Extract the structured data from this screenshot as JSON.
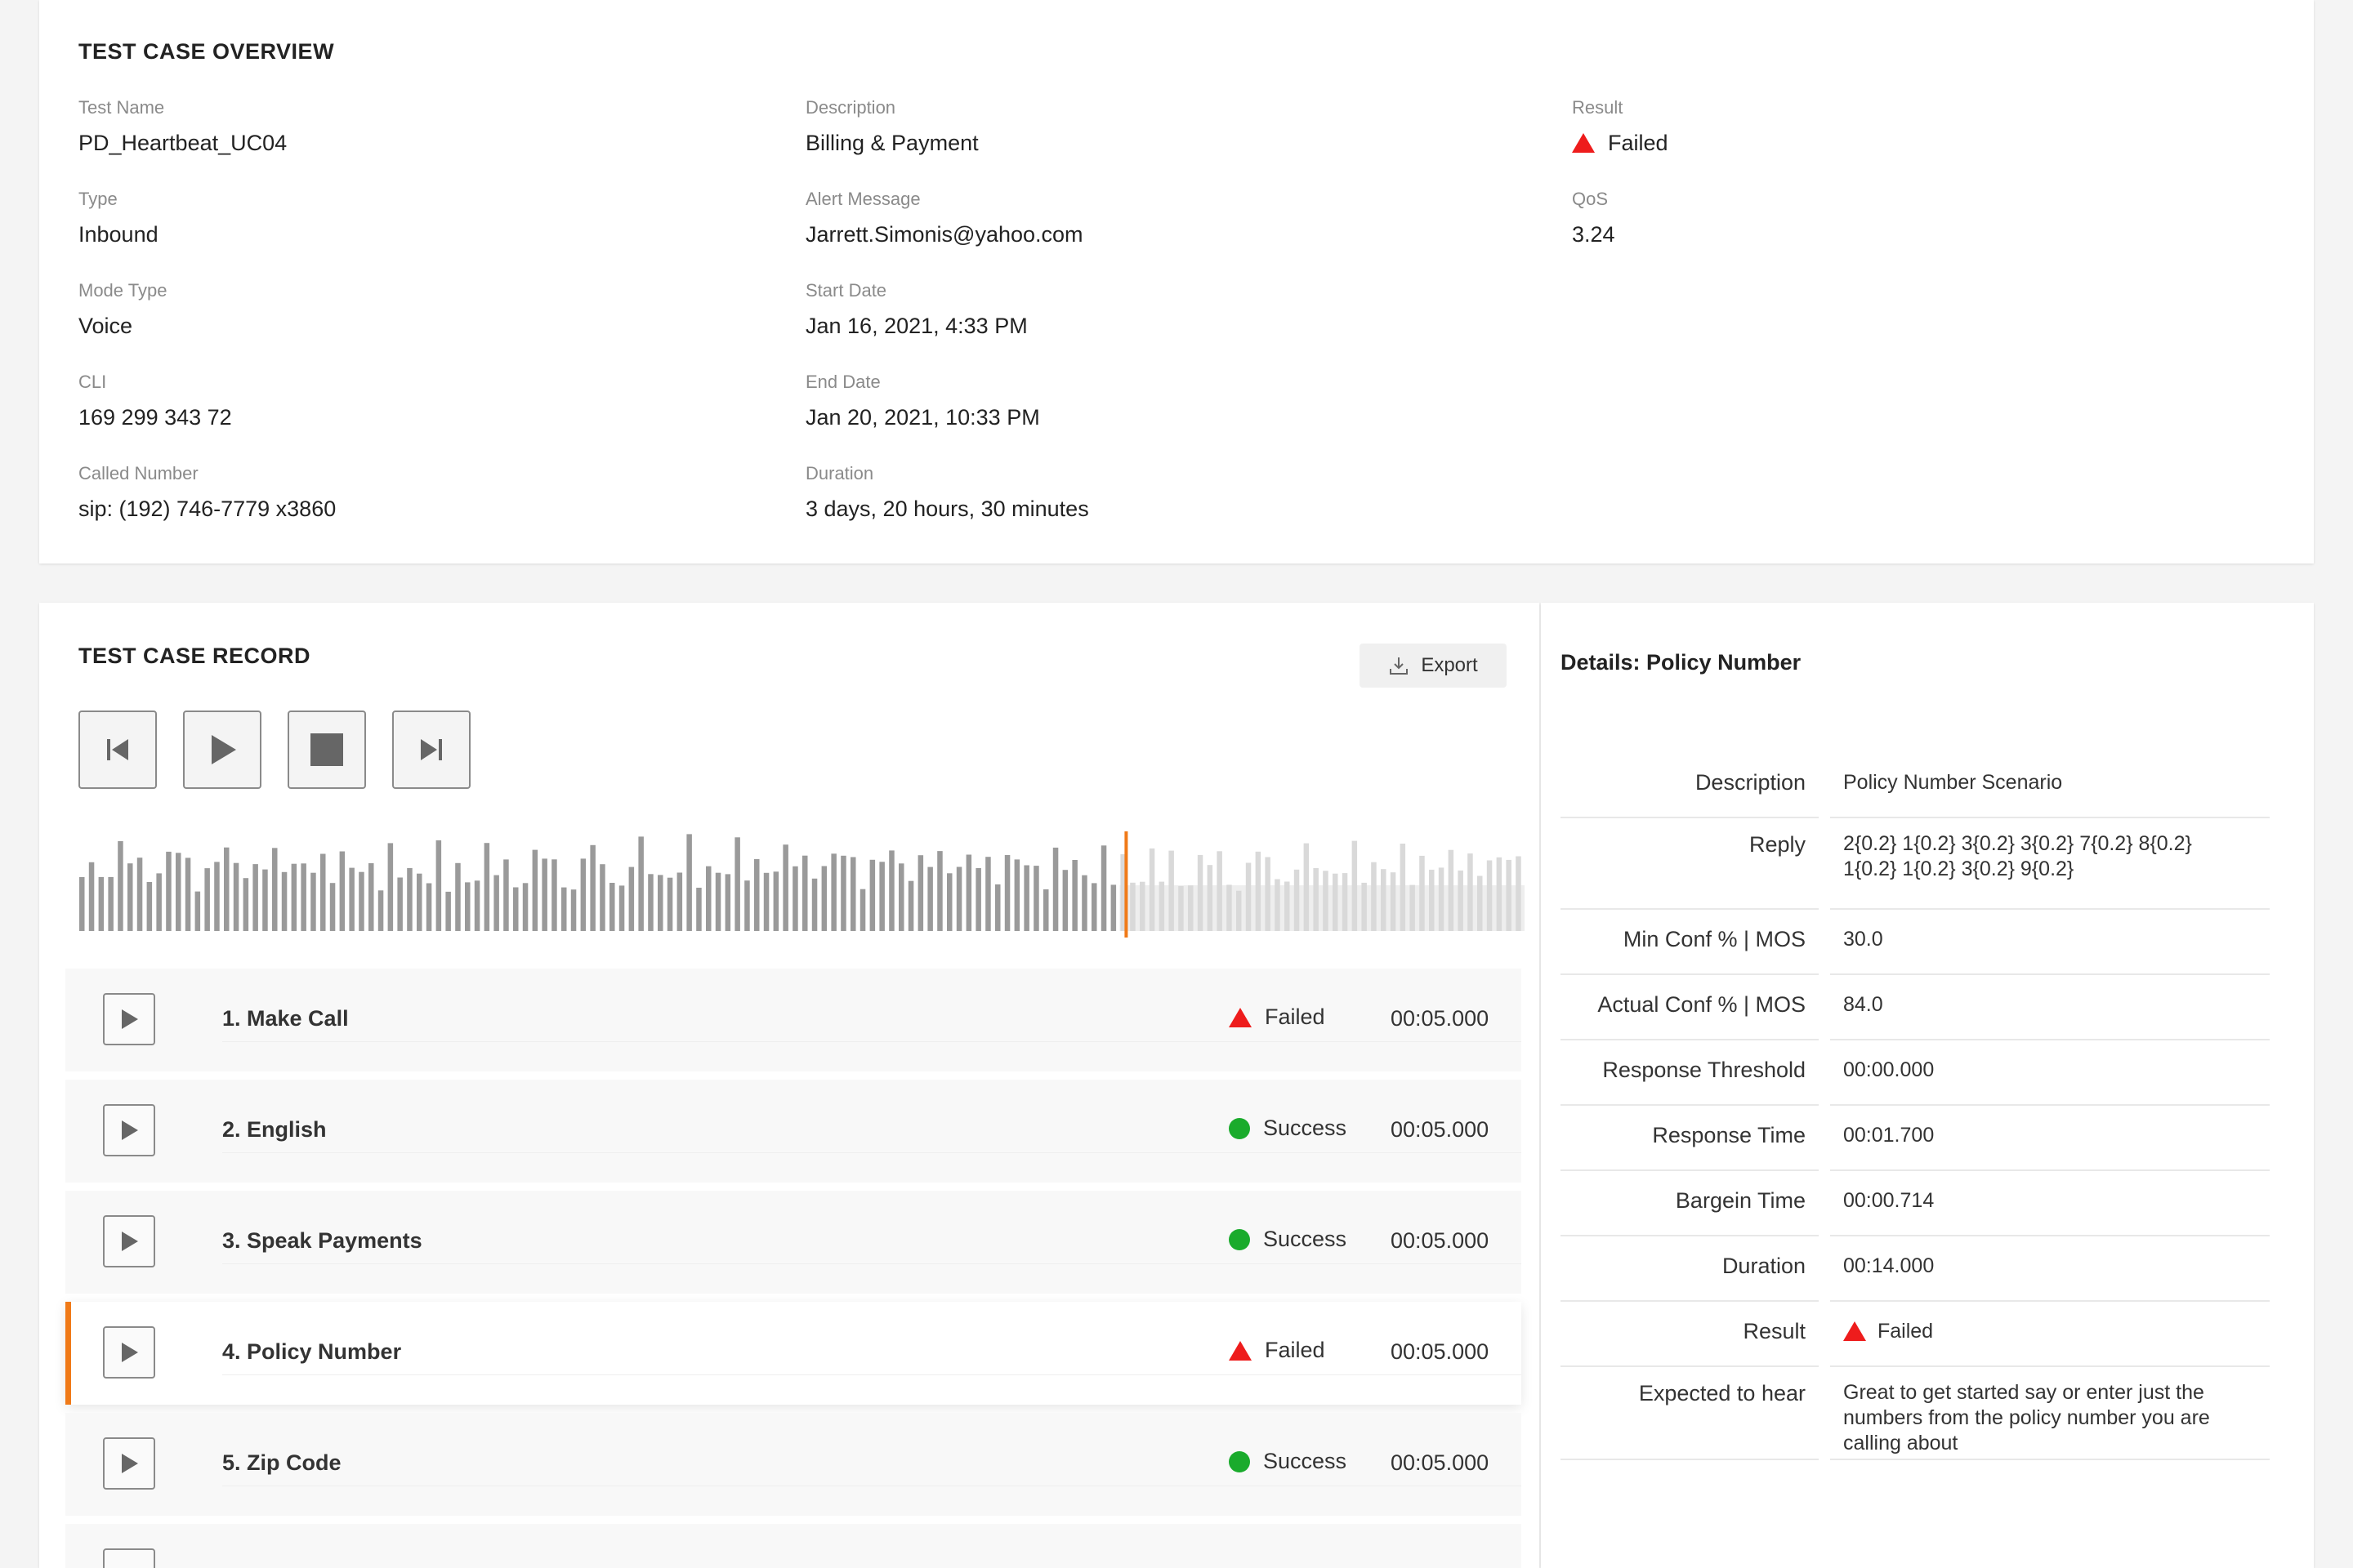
{
  "overview": {
    "title": "TEST CASE OVERVIEW",
    "test_name": {
      "label": "Test Name",
      "value": "PD_Heartbeat_UC04"
    },
    "type": {
      "label": "Type",
      "value": "Inbound"
    },
    "mode_type": {
      "label": "Mode Type",
      "value": "Voice"
    },
    "cli": {
      "label": "CLI",
      "value": "169 299 343 72"
    },
    "called_number": {
      "label": "Called Number",
      "value": "sip: (192) 746-7779 x3860"
    },
    "description": {
      "label": "Description",
      "value": "Billing & Payment"
    },
    "alert_message": {
      "label": "Alert Message",
      "value": "Jarrett.Simonis@yahoo.com"
    },
    "start_date": {
      "label": "Start Date",
      "value": "Jan 16, 2021, 4:33 PM"
    },
    "end_date": {
      "label": "End Date",
      "value": "Jan 20, 2021, 10:33 PM"
    },
    "duration": {
      "label": "Duration",
      "value": "3 days, 20 hours, 30 minutes"
    },
    "result": {
      "label": "Result",
      "value": "Failed"
    },
    "qos": {
      "label": "QoS",
      "value": "3.24"
    }
  },
  "record": {
    "title": "TEST CASE RECORD",
    "export_label": "Export",
    "playback_progress": 0.72,
    "steps": [
      {
        "name": "1. Make Call",
        "status": "Failed",
        "time": "00:05.000"
      },
      {
        "name": "2. English",
        "status": "Success",
        "time": "00:05.000"
      },
      {
        "name": "3. Speak Payments",
        "status": "Success",
        "time": "00:05.000"
      },
      {
        "name": "4. Policy Number",
        "status": "Failed",
        "time": "00:05.000"
      },
      {
        "name": "5. Zip Code",
        "status": "Success",
        "time": "00:05.000"
      }
    ]
  },
  "details": {
    "title": "Details: Policy Number",
    "rows": [
      {
        "key": "Description",
        "value": "Policy Number Scenario"
      },
      {
        "key": "Reply",
        "value_lines": [
          "2{0.2} 1{0.2} 3{0.2} 3{0.2} 7{0.2} 8{0.2}",
          "1{0.2} 1{0.2} 3{0.2} 9{0.2}"
        ]
      },
      {
        "key": "Min Conf % | MOS",
        "value": "30.0"
      },
      {
        "key": "Actual Conf % | MOS",
        "value": "84.0"
      },
      {
        "key": "Response Threshold",
        "value": "00:00.000"
      },
      {
        "key": "Response Time",
        "value": "00:01.700"
      },
      {
        "key": "Bargein Time",
        "value": "00:00.714"
      },
      {
        "key": "Duration",
        "value": "00:14.000"
      },
      {
        "key": "Result",
        "value": "Failed"
      },
      {
        "key": "Expected to hear",
        "value_lines": [
          "Great to get started say or enter just the",
          "numbers from the policy number you are",
          "calling about"
        ]
      }
    ]
  },
  "colors": {
    "failed": "#ee1c1c",
    "success": "#1aab2c",
    "accent": "#f07a18"
  }
}
